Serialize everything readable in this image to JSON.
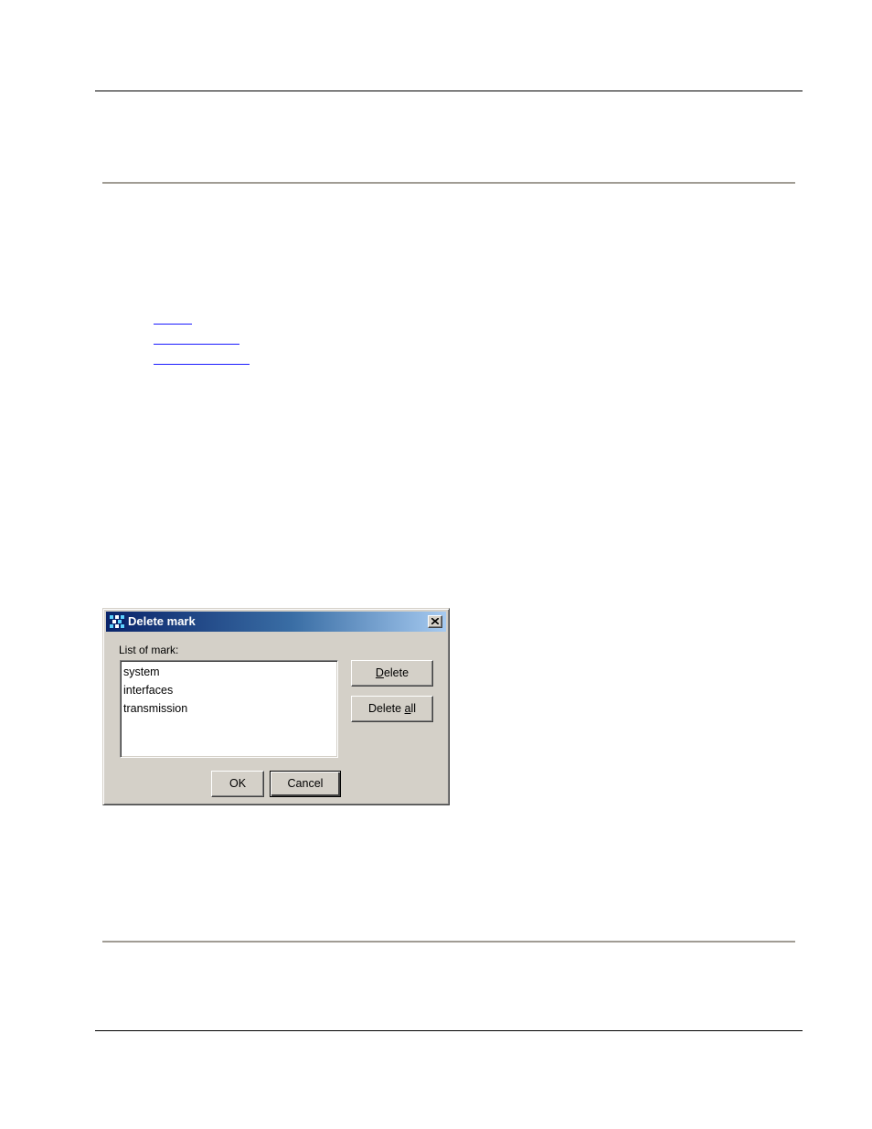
{
  "dialog": {
    "title": "Delete mark",
    "list_label": "List of mark:",
    "list_items": [
      "system",
      "interfaces",
      "transmission"
    ],
    "buttons": {
      "delete": {
        "pre": "",
        "accel": "D",
        "post": "elete"
      },
      "delete_all": {
        "pre": "Delete ",
        "accel": "a",
        "post": "ll"
      },
      "ok": "OK",
      "cancel": "Cancel"
    }
  },
  "colors": {
    "dialog_face": "#d4d0c8",
    "titlebar_start": "#0a246a",
    "titlebar_end": "#a6caf0",
    "link": "#1a1aff"
  }
}
